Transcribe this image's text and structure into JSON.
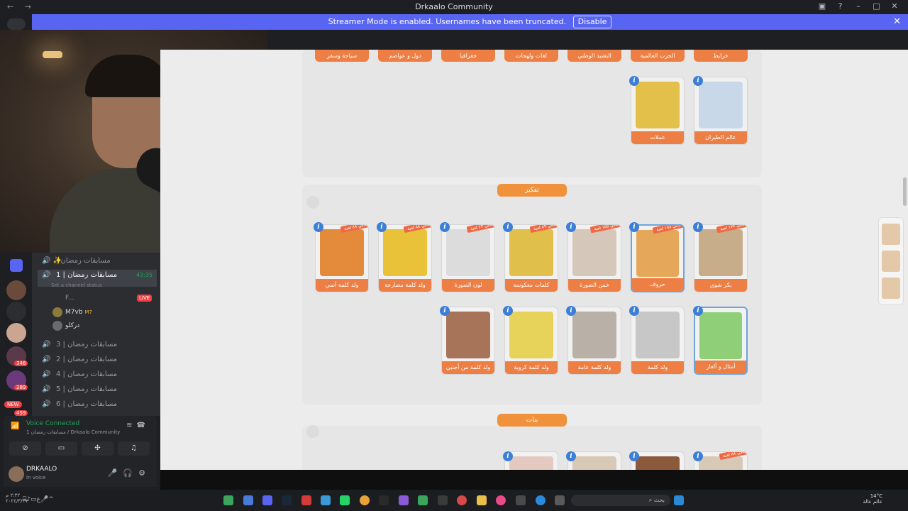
{
  "window": {
    "title": "Drkaalo Community",
    "nav": "← →"
  },
  "banner": {
    "text": "Streamer Mode is enabled. Usernames have been truncated.",
    "disable": "Disable"
  },
  "sidebar": {
    "channels": [
      {
        "name": "مسابقات رمضان |",
        "icon": "speaker-icon"
      },
      {
        "name": "مسابقات رمضان | 1",
        "time": "43:35"
      },
      {
        "name": "مسابقات رمضان | 3"
      },
      {
        "name": "مسابقات رمضان | 2"
      },
      {
        "name": "مسابقات رمضان | 4"
      },
      {
        "name": "مسابقات رمضان | 5"
      },
      {
        "name": "مسابقات رمضان | 6"
      }
    ],
    "status_hint": "Set a channel status",
    "stream_user": "F...",
    "live": "LIVE",
    "members": [
      {
        "name": "M7vb",
        "tag": "M7"
      },
      {
        "name": "دركلو"
      }
    ],
    "badges": [
      "346",
      "289",
      "NEW",
      "459"
    ]
  },
  "voice": {
    "status": "Voice Connected",
    "sub": "1 مسابقات رمضان / Drkaalo Community",
    "buttons": [
      "video-off-icon",
      "screen-share-icon",
      "activities-icon",
      "soundboard-icon"
    ]
  },
  "user": {
    "name": "DRKAALO",
    "sub": "In voice"
  },
  "game": {
    "top_row": [
      "خرايط",
      "الحرب العالمية",
      "النشيد الوطني",
      "لغات ولهجات",
      "جغرافيا",
      "دول و عواصم",
      "سياحة وسفر"
    ],
    "row2": [
      {
        "label": "عالم الطيران",
        "color": "#c9d8e8"
      },
      {
        "label": "عملات",
        "color": "#e3c04a"
      }
    ],
    "section_think": "تفكير",
    "think_row1": [
      {
        "label": "بكر شوي",
        "rib": "باقي ١٧٧ لعبة",
        "color": "#c8ad8a"
      },
      {
        "label": "حروف",
        "rib": "باقي ١٥٨ لعبة",
        "color": "#e5a85a",
        "selected": true
      },
      {
        "label": "خمن الصورة",
        "rib": "باقي ١٥٥ لعبة",
        "color": "#d6c7bb"
      },
      {
        "label": "كلمات معكوسة",
        "rib": "باقي ٨٩ لعبة",
        "color": "#e0c04a"
      },
      {
        "label": "لون الصورة",
        "rib": "باقي ٢٣ لعبة",
        "color": "#dcdcdc"
      },
      {
        "label": "ولد كلمة مصارعة",
        "rib": "باقي ٨٨ لعبة",
        "color": "#e9c23a"
      },
      {
        "label": "ولد كلمة أنمي",
        "rib": "باقي ٤٨ لعبة",
        "color": "#e38b3a"
      }
    ],
    "think_row2": [
      {
        "label": "أمثال و ألغاز",
        "color": "#8fcf78",
        "selected": true
      },
      {
        "label": "ولد كلمة",
        "color": "#c7c7c7"
      },
      {
        "label": "ولد كلمة عامة",
        "color": "#b9b0a8"
      },
      {
        "label": "ولد كلمة كروية",
        "color": "#e8d35a"
      },
      {
        "label": "ولد كلمة من أجنبي",
        "color": "#a7745a"
      }
    ],
    "section_girls": "بنات",
    "bottom_rib": "باقي ٨٨ لعبة",
    "info": "i"
  },
  "taskbar": {
    "search_placeholder": "بحث",
    "weather": "14°C",
    "weather_sub": "عالم عالة",
    "left_text": "٢:٣٢ م",
    "left_sub": "٢٠٢٤/٣/٢٧",
    "lang": "ع"
  }
}
